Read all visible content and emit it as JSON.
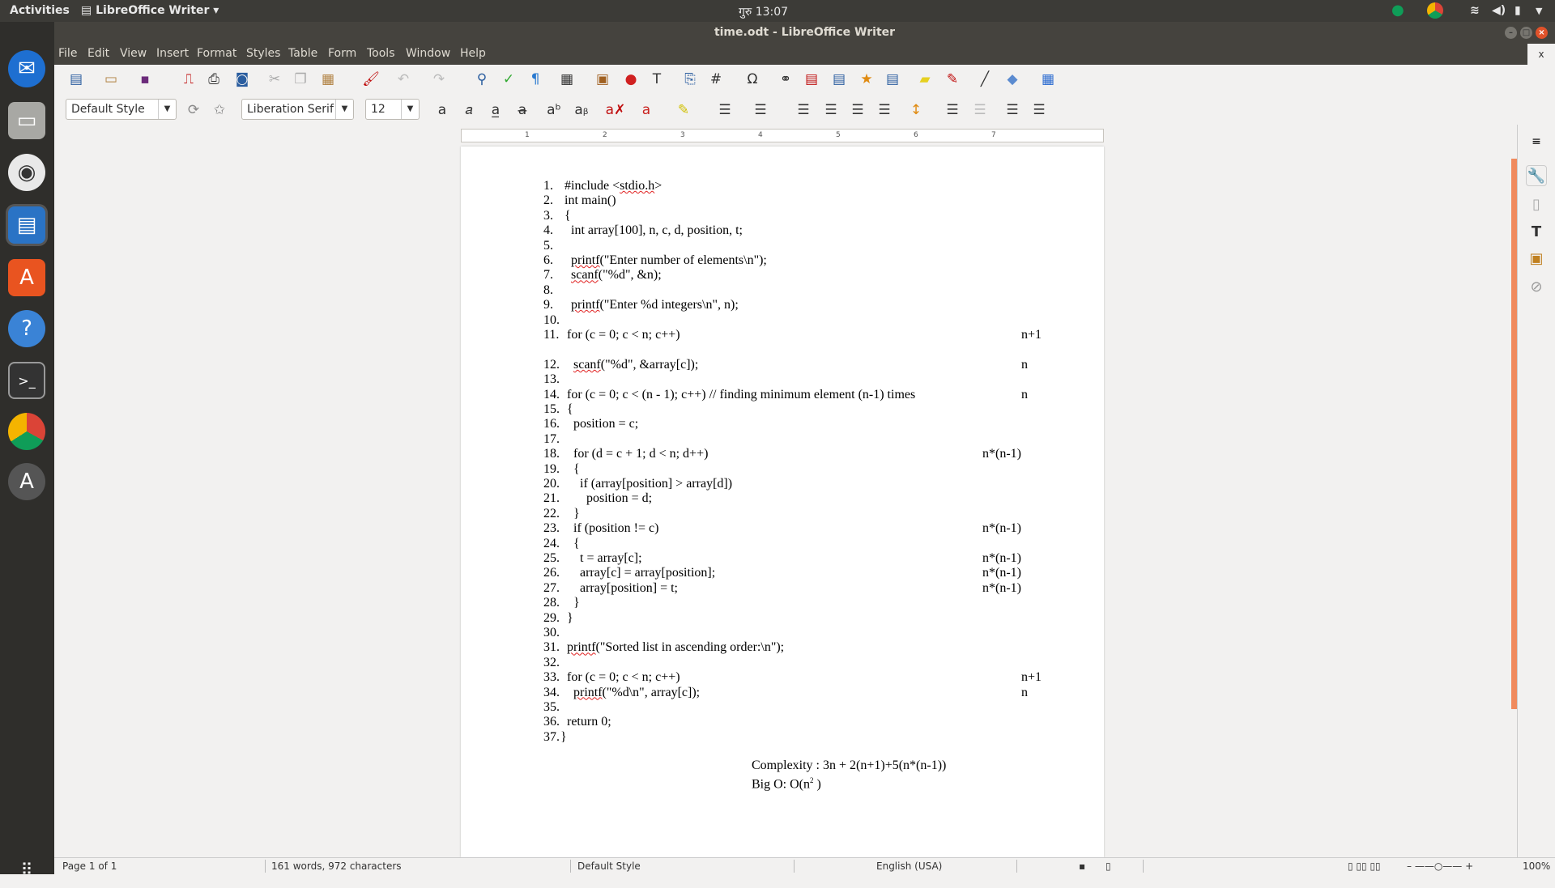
{
  "topbar": {
    "activities": "Activities",
    "app_menu": "LibreOffice Writer",
    "clock": "गुरु 13:07"
  },
  "window": {
    "title": "time.odt - LibreOffice Writer",
    "close_doc": "x"
  },
  "menu": [
    "File",
    "Edit",
    "View",
    "Insert",
    "Format",
    "Styles",
    "Table",
    "Form",
    "Tools",
    "Window",
    "Help"
  ],
  "formatting": {
    "paragraph_style": "Default Style",
    "font_name": "Liberation Serif",
    "font_size": "12"
  },
  "document": {
    "lines": [
      {
        "n": "1.",
        "t": "#include <stdio.h>",
        "miss": "stdio.h",
        "a": ""
      },
      {
        "n": "2.",
        "t": "int main()",
        "a": ""
      },
      {
        "n": "3.",
        "t": "{",
        "a": ""
      },
      {
        "n": "4.",
        "t": "  int array[100], n, c, d, position, t;",
        "a": ""
      },
      {
        "n": "5.",
        "t": "",
        "a": ""
      },
      {
        "n": "6.",
        "t": "  printf(\"Enter number of elements\\n\");",
        "miss": "printf",
        "a": ""
      },
      {
        "n": "7.",
        "t": "  scanf(\"%d\", &n);",
        "miss": "scanf",
        "a": ""
      },
      {
        "n": "8.",
        "t": "",
        "a": ""
      },
      {
        "n": "9.",
        "t": "  printf(\"Enter %d integers\\n\", n);",
        "miss": "printf",
        "a": ""
      },
      {
        "n": "10.",
        "t": "",
        "a": ""
      },
      {
        "n": "11.",
        "t": "  for (c = 0; c < n; c++)",
        "a": "n+1"
      },
      {
        "n": "12.",
        "t": "    scanf(\"%d\", &array[c]);",
        "miss": "scanf",
        "a": "n"
      },
      {
        "n": "13.",
        "t": "",
        "a": ""
      },
      {
        "n": "14.",
        "t": "  for (c = 0; c < (n - 1); c++) // finding minimum element (n-1) times",
        "a": "n"
      },
      {
        "n": "15.",
        "t": "  {",
        "a": ""
      },
      {
        "n": "16.",
        "t": "    position = c;",
        "a": ""
      },
      {
        "n": "17.",
        "t": "",
        "a": ""
      },
      {
        "n": "18.",
        "t": "    for (d = c + 1; d < n; d++)",
        "a": "n*(n-1)"
      },
      {
        "n": "19.",
        "t": "    {",
        "a": ""
      },
      {
        "n": "20.",
        "t": "      if (array[position] > array[d])",
        "a": ""
      },
      {
        "n": "21.",
        "t": "        position = d;",
        "a": ""
      },
      {
        "n": "22.",
        "t": "    }",
        "a": ""
      },
      {
        "n": "23.",
        "t": "    if (position != c)",
        "a": "n*(n-1)"
      },
      {
        "n": "24.",
        "t": "    {",
        "a": ""
      },
      {
        "n": "25.",
        "t": "      t = array[c];",
        "a": "n*(n-1)"
      },
      {
        "n": "26.",
        "t": "      array[c] = array[position];",
        "a": "n*(n-1)"
      },
      {
        "n": "27.",
        "t": "      array[position] = t;",
        "a": "n*(n-1)"
      },
      {
        "n": "28.",
        "t": "    }",
        "a": ""
      },
      {
        "n": "29.",
        "t": "  }",
        "a": ""
      },
      {
        "n": "30.",
        "t": "",
        "a": ""
      },
      {
        "n": "31.",
        "t": "  printf(\"Sorted list in ascending order:\\n\");",
        "miss": "printf",
        "a": ""
      },
      {
        "n": "32.",
        "t": "",
        "a": ""
      },
      {
        "n": "33.",
        "t": "  for (c = 0; c < n; c++)",
        "a": "n+1"
      },
      {
        "n": "34.",
        "t": "    printf(\"%d\\n\", array[c]);",
        "miss": "printf",
        "a": "n"
      },
      {
        "n": "35.",
        "t": "",
        "a": ""
      },
      {
        "n": "36.",
        "t": "  return 0;",
        "a": ""
      },
      {
        "n": "37.",
        "t": "}",
        "a": ""
      }
    ],
    "complexity": "Complexity : 3n + 2(n+1)+5(n*(n-1))",
    "bigo_prefix": "Big O: O(n",
    "bigo_sup": "2",
    "bigo_suffix": " )"
  },
  "ruler": {
    "ticks": [
      "1",
      "2",
      "3",
      "4",
      "5",
      "6",
      "7"
    ]
  },
  "status": {
    "page": "Page 1 of 1",
    "words": "161 words, 972 characters",
    "style": "Default Style",
    "language": "English (USA)",
    "zoom": "100%"
  },
  "colors": {
    "accent": "#f08a5d",
    "font_color": "#c9211e",
    "highlight": "#ffff00"
  }
}
